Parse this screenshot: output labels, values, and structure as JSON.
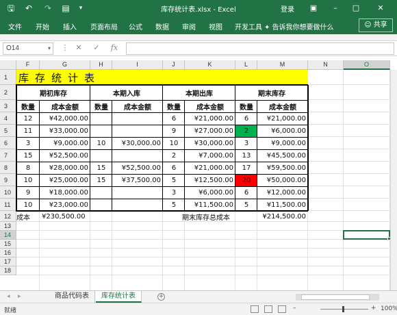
{
  "window": {
    "title": "库存统计表.xlsx  -  Excel",
    "login": "登录"
  },
  "ribbon": {
    "tabs": [
      "文件",
      "开始",
      "插入",
      "页面布局",
      "公式",
      "数据",
      "审阅",
      "视图",
      "开发工具"
    ],
    "tell_me": "告诉我你想要做什么",
    "share": "共享"
  },
  "formula_bar": {
    "name_box": "O14",
    "formula": ""
  },
  "columns": [
    "F",
    "G",
    "H",
    "I",
    "J",
    "K",
    "L",
    "M",
    "N",
    "O"
  ],
  "rows": [
    "1",
    "2",
    "3",
    "4",
    "5",
    "6",
    "7",
    "8",
    "9",
    "10",
    "11",
    "12",
    "13",
    "14",
    "15",
    "16",
    "17",
    "18"
  ],
  "sheet": {
    "title": "库存统计表",
    "group_headers": [
      "期初库存",
      "本期入库",
      "本期出库",
      "期末库存"
    ],
    "sub_headers": [
      "数量",
      "成本金额",
      "数量",
      "成本金额",
      "数量",
      "成本金额",
      "数量",
      "成本金额"
    ],
    "data": [
      [
        "12",
        "¥42,000.00",
        "",
        "",
        "6",
        "¥21,000.00",
        "6",
        "¥21,000.00"
      ],
      [
        "11",
        "¥33,000.00",
        "",
        "",
        "9",
        "¥27,000.00",
        "2",
        "¥6,000.00"
      ],
      [
        "3",
        "¥9,000.00",
        "10",
        "¥30,000.00",
        "10",
        "¥30,000.00",
        "3",
        "¥9,000.00"
      ],
      [
        "15",
        "¥52,500.00",
        "",
        "",
        "2",
        "¥7,000.00",
        "13",
        "¥45,500.00"
      ],
      [
        "8",
        "¥28,000.00",
        "15",
        "¥52,500.00",
        "6",
        "¥21,000.00",
        "17",
        "¥59,500.00"
      ],
      [
        "10",
        "¥25,000.00",
        "15",
        "¥37,500.00",
        "5",
        "¥12,500.00",
        "20",
        "¥50,000.00"
      ],
      [
        "9",
        "¥18,000.00",
        "",
        "",
        "3",
        "¥6,000.00",
        "6",
        "¥12,000.00"
      ],
      [
        "10",
        "¥23,000.00",
        "",
        "",
        "5",
        "¥11,500.00",
        "5",
        "¥11,500.00"
      ]
    ],
    "highlight_green_row": 1,
    "highlight_red_row": 5,
    "highlight_colors": {
      "green": "#00b050",
      "red": "#ff0000"
    },
    "summary": {
      "label": "成本",
      "value": "¥230,500.00",
      "end_label": "期末库存总成本",
      "end_value": "¥214,500.00"
    }
  },
  "sheet_tabs": [
    "商品代码表",
    "库存统计表"
  ],
  "active_tab": 1,
  "status": {
    "ready": "就绪",
    "zoom": "100%"
  },
  "colors": {
    "accent": "#217346",
    "title_fill": "#ffff00"
  }
}
